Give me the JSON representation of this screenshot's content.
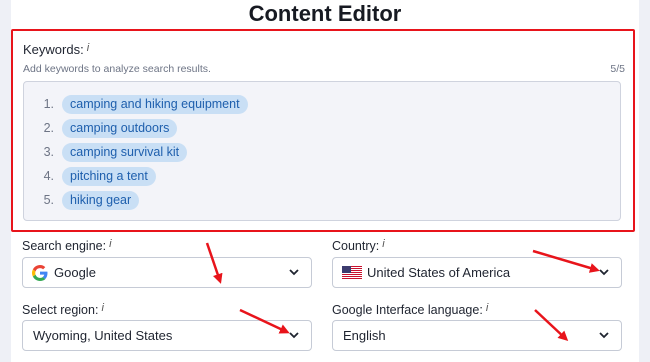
{
  "page_title": "Content Editor",
  "keywords": {
    "label": "Keywords:",
    "info": "i",
    "hint": "Add keywords to analyze search results.",
    "count": "5/5",
    "items": [
      {
        "num": "1.",
        "text": "camping and hiking equipment"
      },
      {
        "num": "2.",
        "text": "camping outdoors"
      },
      {
        "num": "3.",
        "text": "camping survival kit"
      },
      {
        "num": "4.",
        "text": "pitching a tent"
      },
      {
        "num": "5.",
        "text": "hiking gear"
      }
    ]
  },
  "search_engine": {
    "label": "Search engine:",
    "info": "i",
    "value": "Google",
    "icon": "google-icon"
  },
  "country": {
    "label": "Country:",
    "info": "i",
    "value": "United States of America",
    "icon": "us-flag-icon"
  },
  "region": {
    "label": "Select region:",
    "info": "i",
    "value": "Wyoming, United States"
  },
  "language": {
    "label": "Google Interface language:",
    "info": "i",
    "value": "English"
  },
  "colors": {
    "highlight_border": "#e8141b",
    "pill_bg": "#c9dff5",
    "pill_text": "#1e5fad",
    "arrow": "#e8141b"
  }
}
